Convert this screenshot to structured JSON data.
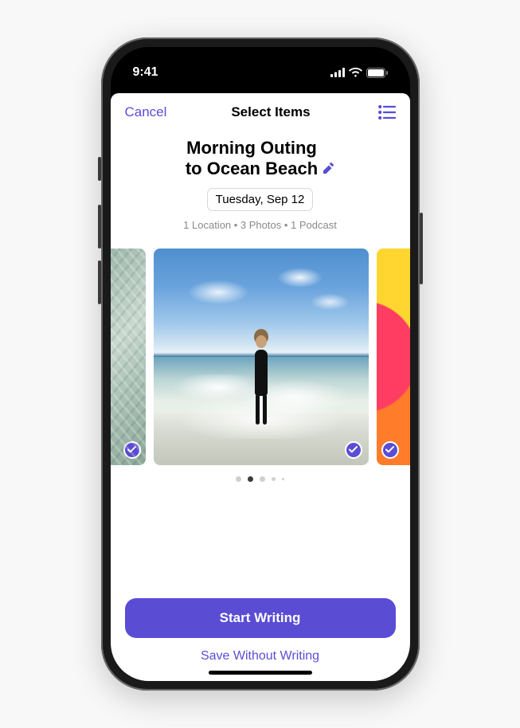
{
  "status": {
    "time": "9:41"
  },
  "nav": {
    "cancel": "Cancel",
    "title": "Select Items"
  },
  "header": {
    "title_line1": "Morning Outing",
    "title_line2": "to Ocean Beach",
    "date": "Tuesday, Sep 12",
    "meta": "1 Location • 3 Photos • 1 Podcast"
  },
  "carousel": {
    "items": [
      {
        "kind": "photo",
        "selected": true,
        "desc": "knit-fabric"
      },
      {
        "kind": "photo",
        "selected": true,
        "desc": "beach-runner"
      },
      {
        "kind": "podcast",
        "selected": true,
        "desc": "podcast-art"
      }
    ],
    "active_index": 1,
    "total_dots": 5
  },
  "actions": {
    "primary": "Start Writing",
    "secondary": "Save Without Writing"
  },
  "colors": {
    "accent": "#5a4dd4"
  }
}
